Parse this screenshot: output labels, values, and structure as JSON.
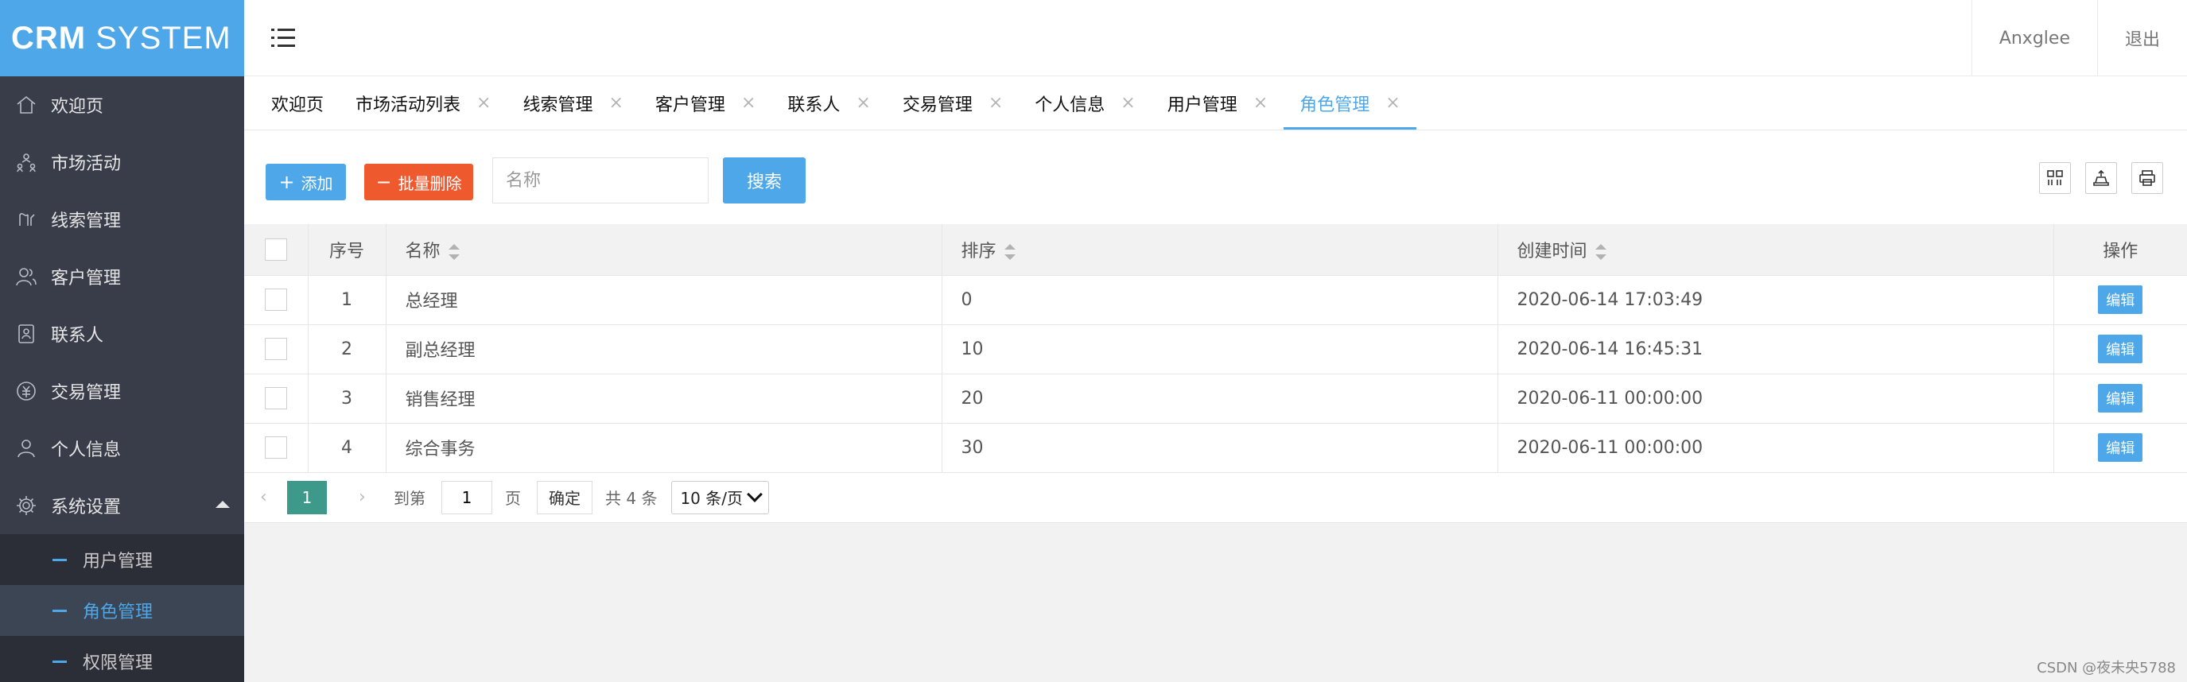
{
  "app": {
    "logo_bold": "CRM",
    "logo_rest": " SYSTEM"
  },
  "sidebar": {
    "items": [
      {
        "label": "欢迎页",
        "icon": "home-icon"
      },
      {
        "label": "市场活动",
        "icon": "activity-icon"
      },
      {
        "label": "线索管理",
        "icon": "clue-icon"
      },
      {
        "label": "客户管理",
        "icon": "customer-icon"
      },
      {
        "label": "联系人",
        "icon": "contact-icon"
      },
      {
        "label": "交易管理",
        "icon": "transaction-icon"
      },
      {
        "label": "个人信息",
        "icon": "user-icon"
      },
      {
        "label": "系统设置",
        "icon": "gear-icon"
      }
    ],
    "sub_items": [
      {
        "label": "用户管理"
      },
      {
        "label": "角色管理"
      },
      {
        "label": "权限管理"
      }
    ]
  },
  "header": {
    "username": "Anxglee",
    "logout": "退出"
  },
  "tabs": [
    {
      "label": "欢迎页"
    },
    {
      "label": "市场活动列表"
    },
    {
      "label": "线索管理"
    },
    {
      "label": "客户管理"
    },
    {
      "label": "联系人"
    },
    {
      "label": "交易管理"
    },
    {
      "label": "个人信息"
    },
    {
      "label": "用户管理"
    },
    {
      "label": "角色管理"
    }
  ],
  "tab_close": "×",
  "toolbar": {
    "add_label": "添加",
    "batch_delete_label": "批量删除",
    "search_placeholder": "名称",
    "search_label": "搜索"
  },
  "table": {
    "headers": {
      "index": "序号",
      "name": "名称",
      "sort": "排序",
      "created": "创建时间",
      "action": "操作"
    },
    "rows": [
      {
        "index": "1",
        "name": "总经理",
        "sort": "0",
        "created": "2020-06-14 17:03:49",
        "action": "编辑"
      },
      {
        "index": "2",
        "name": "副总经理",
        "sort": "10",
        "created": "2020-06-14 16:45:31",
        "action": "编辑"
      },
      {
        "index": "3",
        "name": "销售经理",
        "sort": "20",
        "created": "2020-06-11 00:00:00",
        "action": "编辑"
      },
      {
        "index": "4",
        "name": "综合事务",
        "sort": "30",
        "created": "2020-06-11 00:00:00",
        "action": "编辑"
      }
    ]
  },
  "pager": {
    "prev": "‹",
    "current": "1",
    "next": "›",
    "goto_label": "到第",
    "goto_value": "1",
    "page_unit": "页",
    "confirm": "确定",
    "total": "共 4 条",
    "page_size": "10 条/页"
  },
  "watermark": "CSDN @夜未央5788",
  "colors": {
    "accent": "#4da7e8",
    "sidebar": "#393d49",
    "danger": "#ee5a2e",
    "pager_active": "#3d9a8b"
  }
}
